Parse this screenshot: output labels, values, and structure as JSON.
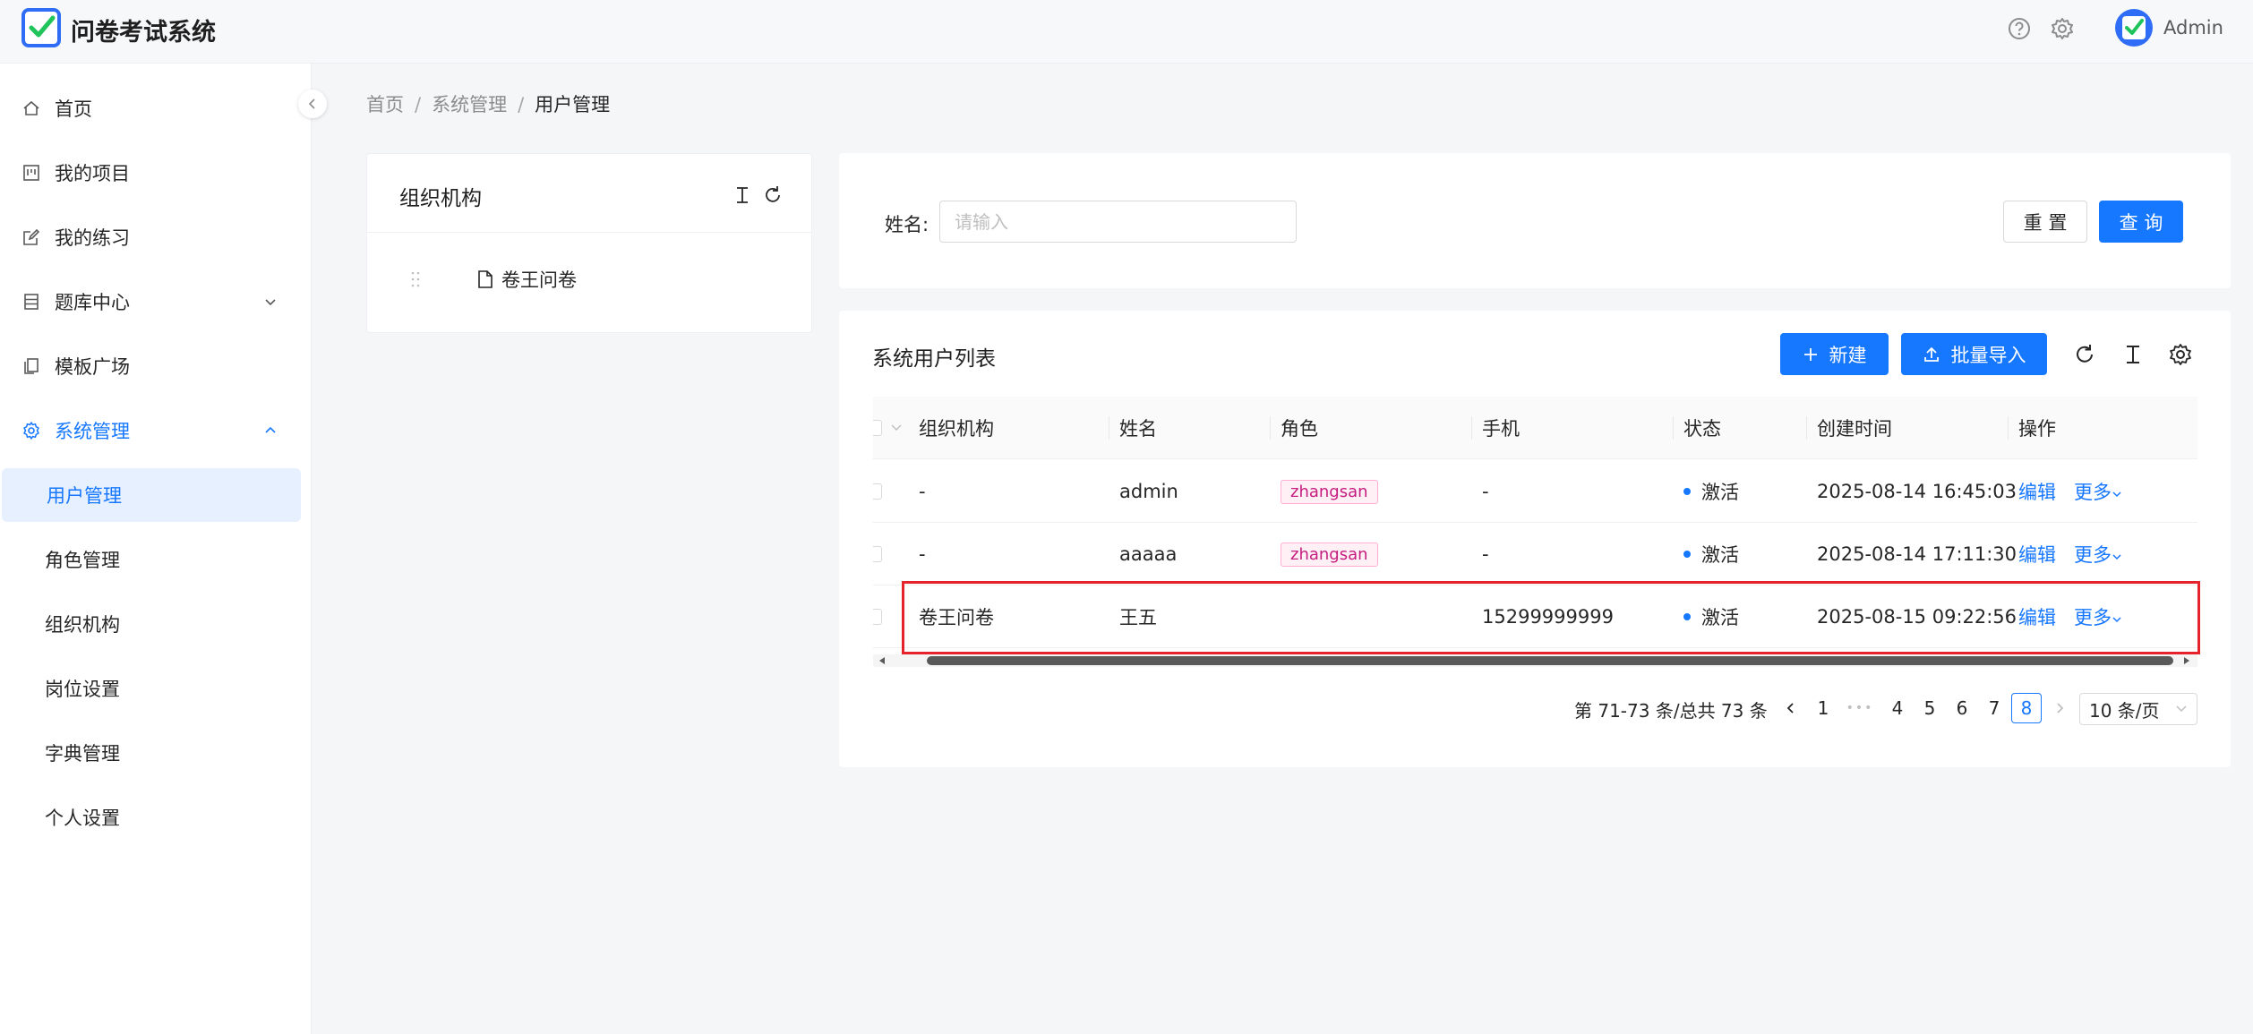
{
  "header": {
    "app_title": "问卷考试系统",
    "user_name": "Admin"
  },
  "sidebar": {
    "items": [
      {
        "label": "首页",
        "icon": "home-icon"
      },
      {
        "label": "我的项目",
        "icon": "project-icon"
      },
      {
        "label": "我的练习",
        "icon": "edit-icon"
      },
      {
        "label": "题库中心",
        "icon": "database-icon"
      },
      {
        "label": "模板广场",
        "icon": "copy-icon"
      },
      {
        "label": "系统管理",
        "icon": "gear-icon"
      }
    ],
    "sub_items": [
      {
        "label": "用户管理",
        "active": true
      },
      {
        "label": "角色管理"
      },
      {
        "label": "组织机构"
      },
      {
        "label": "岗位设置"
      },
      {
        "label": "字典管理"
      },
      {
        "label": "个人设置"
      }
    ]
  },
  "breadcrumb": {
    "items": [
      "首页",
      "系统管理",
      "用户管理"
    ],
    "sep": "/"
  },
  "org_panel": {
    "title": "组织机构",
    "tree": [
      {
        "label": "卷王问卷"
      }
    ]
  },
  "search": {
    "label": "姓名:",
    "placeholder": "请输入",
    "reset_label": "重 置",
    "query_label": "查 询"
  },
  "list": {
    "title": "系统用户列表",
    "new_label": "新建",
    "import_label": "批量导入",
    "columns": [
      "组织机构",
      "姓名",
      "角色",
      "手机",
      "状态",
      "创建时间",
      "操作"
    ],
    "rows": [
      {
        "org": "-",
        "name": "admin",
        "role": "zhangsan",
        "phone": "-",
        "status": "激活",
        "created": "2025-08-14 16:45:03",
        "edit": "编辑",
        "more": "更多"
      },
      {
        "org": "-",
        "name": "aaaaa",
        "role": "zhangsan",
        "phone": "-",
        "status": "激活",
        "created": "2025-08-14 17:11:30",
        "edit": "编辑",
        "more": "更多"
      },
      {
        "org": "卷王问卷",
        "name": "王五",
        "role": "",
        "phone": "15299999999",
        "status": "激活",
        "created": "2025-08-15 09:22:56",
        "edit": "编辑",
        "more": "更多"
      }
    ]
  },
  "pagination": {
    "total_text": "第 71-73 条/总共 73 条",
    "pages": [
      "1",
      "•••",
      "4",
      "5",
      "6",
      "7",
      "8"
    ],
    "current": "8",
    "page_size": "10 条/页"
  },
  "colors": {
    "primary": "#1677ff",
    "highlight": "#e5232d",
    "tag_text": "#c41d7f"
  }
}
